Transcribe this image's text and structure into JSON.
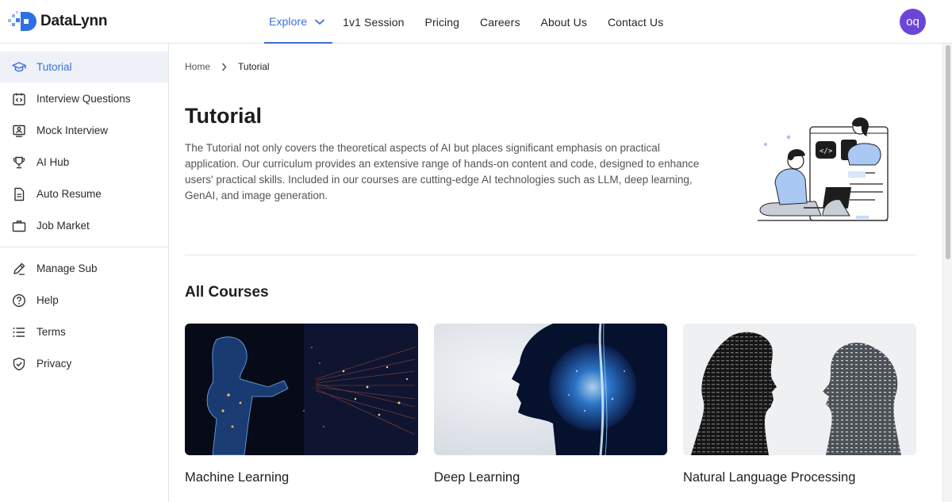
{
  "app": {
    "name": "DataLynn"
  },
  "nav": {
    "items": [
      {
        "label": "Explore",
        "active": true,
        "has_dropdown": true
      },
      {
        "label": "1v1 Session"
      },
      {
        "label": "Pricing"
      },
      {
        "label": "Careers"
      },
      {
        "label": "About Us"
      },
      {
        "label": "Contact Us"
      }
    ]
  },
  "user": {
    "initials": "oq"
  },
  "sidebar": {
    "items": [
      {
        "label": "Tutorial",
        "icon": "graduation-cap-icon",
        "active": true
      },
      {
        "label": "Interview Questions",
        "icon": "code-calendar-icon"
      },
      {
        "label": "Mock Interview",
        "icon": "person-screen-icon"
      },
      {
        "label": "AI Hub",
        "icon": "trophy-icon"
      },
      {
        "label": "Auto Resume",
        "icon": "document-icon"
      },
      {
        "label": "Job Market",
        "icon": "briefcase-icon"
      }
    ],
    "bottom_items": [
      {
        "label": "Manage Sub",
        "icon": "pencil-icon"
      },
      {
        "label": "Help",
        "icon": "question-circle-icon"
      },
      {
        "label": "Terms",
        "icon": "list-icon"
      },
      {
        "label": "Privacy",
        "icon": "shield-check-icon"
      }
    ]
  },
  "breadcrumb": {
    "home": "Home",
    "current": "Tutorial"
  },
  "page": {
    "title": "Tutorial",
    "description": "The Tutorial not only covers the theoretical aspects of AI but places significant emphasis on practical application. Our curriculum provides an extensive range of hands-on content and code, designed to enhance users' practical skills. Included in our courses are cutting-edge AI technologies such as LLM, deep learning, GenAI, and image generation."
  },
  "courses": {
    "title": "All Courses",
    "items": [
      {
        "title": "Machine Learning"
      },
      {
        "title": "Deep Learning"
      },
      {
        "title": "Natural Language Processing"
      }
    ]
  },
  "colors": {
    "accent": "#3b6fd4",
    "avatar": "#6b45d8",
    "sidebar_active_bg": "#eef1f8"
  }
}
